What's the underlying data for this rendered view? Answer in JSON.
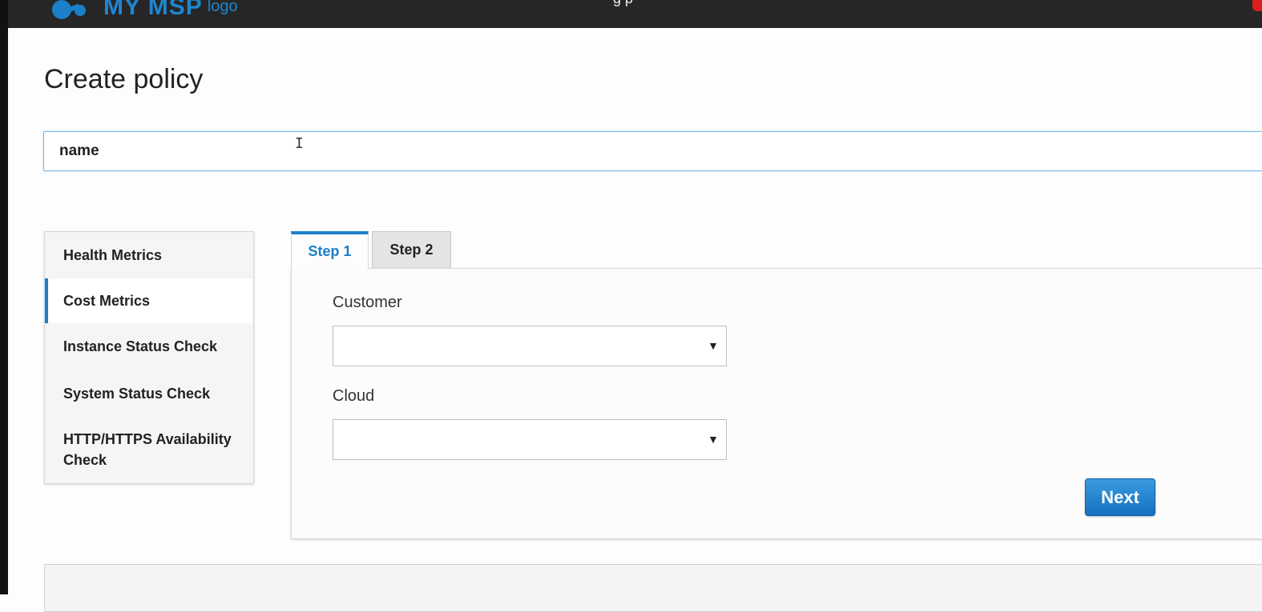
{
  "header": {
    "logo_text": "MY MSP",
    "logo_small": "logo",
    "center_text": "g  p"
  },
  "page": {
    "title": "Create policy"
  },
  "name_input": {
    "value": "name"
  },
  "sidebar": {
    "items": [
      {
        "label": "Health Metrics",
        "active": false
      },
      {
        "label": "Cost Metrics",
        "active": true
      },
      {
        "label": "Instance Status Check",
        "active": false
      },
      {
        "label": "System Status Check",
        "active": false
      },
      {
        "label": "HTTP/HTTPS Availability Check",
        "active": false
      }
    ]
  },
  "tabs": [
    {
      "label": "Step 1",
      "active": true
    },
    {
      "label": "Step 2",
      "active": false
    }
  ],
  "form": {
    "customer_label": "Customer",
    "customer_value": "",
    "cloud_label": "Cloud",
    "cloud_value": "",
    "next_label": "Next"
  },
  "colors": {
    "accent": "#1b7fc9",
    "topbar": "#262626",
    "button": "#1570c0"
  },
  "icons": {
    "dropdown": "triangle-down",
    "cursor": "text-cursor"
  }
}
